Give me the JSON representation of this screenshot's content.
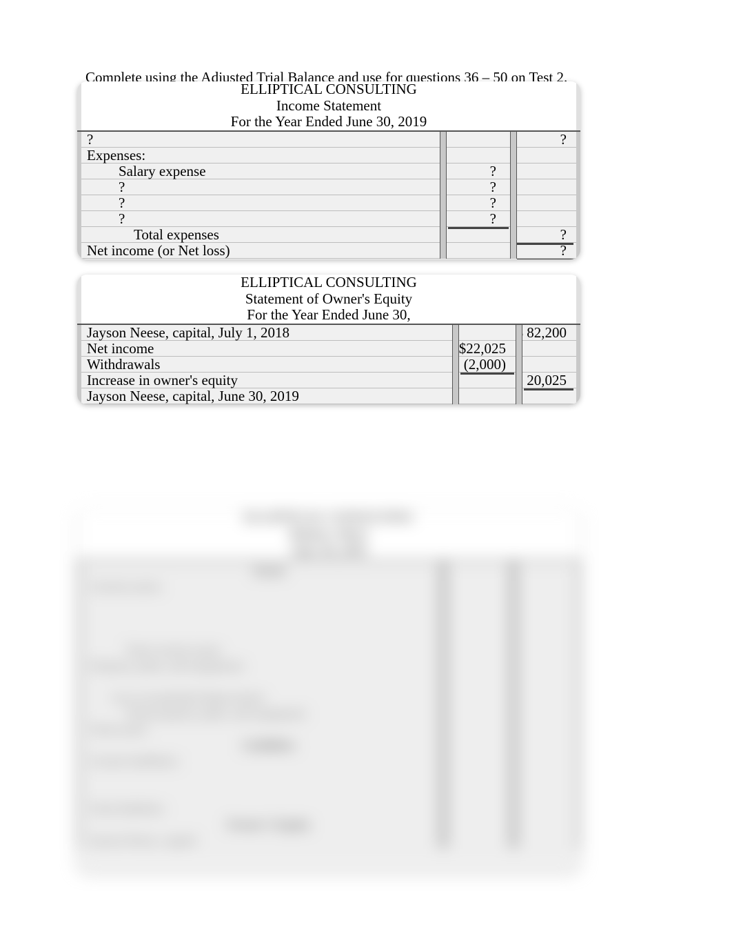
{
  "instruction": "Complete using the Adjusted Trial Balance and use for questions 36 – 50 on Test 2.",
  "income_statement": {
    "company": "ELLIPTICAL  CONSULTING",
    "title": "Income  Statement",
    "period": "For the Year Ended June 30, 2019",
    "rows": [
      {
        "label": "?",
        "indent": 0,
        "col1": "",
        "col2": "?"
      },
      {
        "label": "Expenses:",
        "indent": 0,
        "col1": "",
        "col2": ""
      },
      {
        "label": "Salary  expense",
        "indent": 2,
        "col1": "?",
        "col2": ""
      },
      {
        "label": "?",
        "indent": 2,
        "col1": "?",
        "col2": ""
      },
      {
        "label": "?",
        "indent": 2,
        "col1": "?",
        "col2": ""
      },
      {
        "label": "?",
        "indent": 2,
        "col1": "?",
        "col2": ""
      },
      {
        "label": "Total  expenses",
        "indent": 3,
        "col1": "",
        "col2": "?"
      },
      {
        "label": "Net income (or Net loss)",
        "indent": 0,
        "col1": "",
        "col2": "?"
      }
    ]
  },
  "owners_equity": {
    "company": "ELLIPTICAL  CONSULTING",
    "title": "Statement of Owner's Equity",
    "period": "For the Year Ended June 30,",
    "rows": [
      {
        "label": "Jayson Neese, capital, July 1, 2018",
        "indent": 0,
        "col1": "",
        "col2": "$  82,200"
      },
      {
        "label": "Net  income",
        "indent": 0,
        "col1": "$22,025",
        "col2": ""
      },
      {
        "label": "Withdrawals",
        "indent": 0,
        "col1": "(2,000)",
        "col2": ""
      },
      {
        "label": "Increase in owner's equity",
        "indent": 0,
        "col1": "",
        "col2": "20,025"
      },
      {
        "label": "Jayson Neese, capital, June 30, 2019",
        "indent": 0,
        "col1": "",
        "col2": ""
      }
    ]
  },
  "balance_sheet_blurred": {
    "company": "ELLIPTICAL  CONSULTING",
    "title": "Balance  Sheet",
    "period": "June 30, 2019",
    "sections": {
      "assets_heading": "Assets",
      "current_assets_label": "Current assets:",
      "total_current_assets_label": "Total current assets",
      "ppe_label": "Property, plant, and equipment:",
      "less_accum_dep_label": "Less accumulated depreciation",
      "total_ppe_label": "Total property, plant, and equipment",
      "total_assets_label": "Total assets",
      "liabilities_heading": "Liabilities",
      "current_liabilities_label": "Current liabilities:",
      "total_liabilities_label": "Total liabilities",
      "owners_equity_heading": "Owner's Equity",
      "capital_label": "Jayson Neese, capital"
    }
  }
}
